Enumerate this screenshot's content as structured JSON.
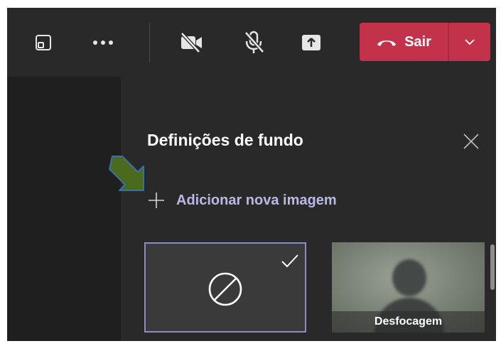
{
  "toolbar": {
    "icons": [
      "screen-layout-icon",
      "more-options-icon",
      "camera-off-icon",
      "mic-off-icon",
      "share-screen-icon"
    ],
    "leave_label": "Sair",
    "leave_icon": "phone-hangup-icon",
    "leave_dropdown_icon": "chevron-down-icon",
    "colors": {
      "background": "#292929",
      "leave": "#c4314b"
    }
  },
  "panel": {
    "title": "Definições de fundo",
    "close_icon": "close-icon",
    "add_icon": "plus-icon",
    "add_label": "Adicionar nova imagem",
    "backgrounds": [
      {
        "kind": "none",
        "icon": "no-background-icon",
        "selected": true,
        "selected_icon": "checkmark-icon"
      },
      {
        "kind": "blur",
        "label": "Desfocagem",
        "selected": false
      }
    ],
    "colors": {
      "background": "#292929",
      "accent": "#8b8cc7",
      "link": "#b9b9e8"
    }
  },
  "annotation": {
    "icon": "pointer-arrow-icon",
    "color": "#4a6b1e"
  }
}
